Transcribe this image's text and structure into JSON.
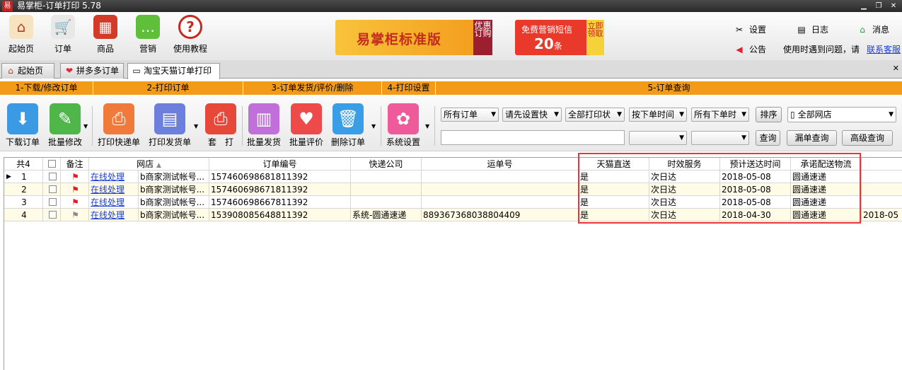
{
  "window": {
    "title": "易掌柜-订单打印 5.78",
    "icon_text": "易"
  },
  "toolbar": {
    "items": [
      {
        "label": "起始页",
        "icon": "house-icon"
      },
      {
        "label": "订单",
        "icon": "cart-icon"
      },
      {
        "label": "商品",
        "icon": "shop-icon"
      },
      {
        "label": "营销",
        "icon": "chat-icon"
      },
      {
        "label": "使用教程",
        "icon": "question-icon"
      }
    ]
  },
  "ads": {
    "ad1_text": "易掌柜标准版",
    "ad1_side": "优惠订购",
    "ad2_text": "免费营销短信",
    "ad2_num": "20",
    "ad2_unit": "条",
    "ad2_side": "立即领取"
  },
  "right_menu": {
    "settings": "设置",
    "log": "日志",
    "messages": "消息",
    "notice": "公告",
    "help_text": "使用时遇到问题，请",
    "contact": "联系客服"
  },
  "tabs": [
    {
      "label": "起始页"
    },
    {
      "label": "拼多多订单"
    },
    {
      "label": "淘宝天猫订单打印"
    }
  ],
  "sections": [
    "1-下载/修改订单",
    "2-打印订单",
    "3-订单发货/评价/删除",
    "4-打印设置",
    "5-订单查询"
  ],
  "actions": [
    {
      "label": "下载订单"
    },
    {
      "label": "批量修改"
    },
    {
      "label": "打印快递单"
    },
    {
      "label": "打印发货单"
    },
    {
      "label": "套　打"
    },
    {
      "label": "批量发货"
    },
    {
      "label": "批量评价"
    },
    {
      "label": "删除订单"
    },
    {
      "label": "系统设置"
    }
  ],
  "filters": {
    "order_type": "所有订单",
    "shortcut": "请先设置快",
    "print_status": "全部打印状",
    "order_by": "按下单时间",
    "time_range": "所有下单时",
    "sort_btn": "排序",
    "shop": "全部网店",
    "query_btn": "查询",
    "leak_query_btn": "漏单查询",
    "adv_query_btn": "高级查询"
  },
  "grid": {
    "columns": [
      "共4",
      "",
      "备注",
      "网店",
      "订单编号",
      "快递公司",
      "运单号",
      "天猫直送",
      "时效服务",
      "预计送达时间",
      "承诺配送物流",
      ""
    ],
    "rows": [
      {
        "no": "1",
        "link": "在线处理",
        "shop": "b商家测试帐号...",
        "order_id": "157460698681811392",
        "express": "",
        "waybill": "",
        "tmall": "是",
        "service": "次日达",
        "eta": "2018-05-08",
        "logistics": "圆通速递",
        "extra": "",
        "flag": "red"
      },
      {
        "no": "2",
        "link": "在线处理",
        "shop": "b商家测试帐号...",
        "order_id": "157460698671811392",
        "express": "",
        "waybill": "",
        "tmall": "是",
        "service": "次日达",
        "eta": "2018-05-08",
        "logistics": "圆通速递",
        "extra": "",
        "flag": "red"
      },
      {
        "no": "3",
        "link": "在线处理",
        "shop": "b商家测试帐号...",
        "order_id": "157460698667811392",
        "express": "",
        "waybill": "",
        "tmall": "是",
        "service": "次日达",
        "eta": "2018-05-08",
        "logistics": "圆通速递",
        "extra": "",
        "flag": "red"
      },
      {
        "no": "4",
        "link": "在线处理",
        "shop": "b商家测试帐号...",
        "order_id": "153908085648811392",
        "express": "系统-圆通速递",
        "waybill": "889367368038804409",
        "tmall": "是",
        "service": "次日达",
        "eta": "2018-04-30",
        "logistics": "圆通速递",
        "extra": "2018-05",
        "flag": "gray"
      }
    ]
  },
  "colors": {
    "section_bar": "#f39a19",
    "highlight": "#e8343b",
    "link": "#1b3dd6"
  }
}
